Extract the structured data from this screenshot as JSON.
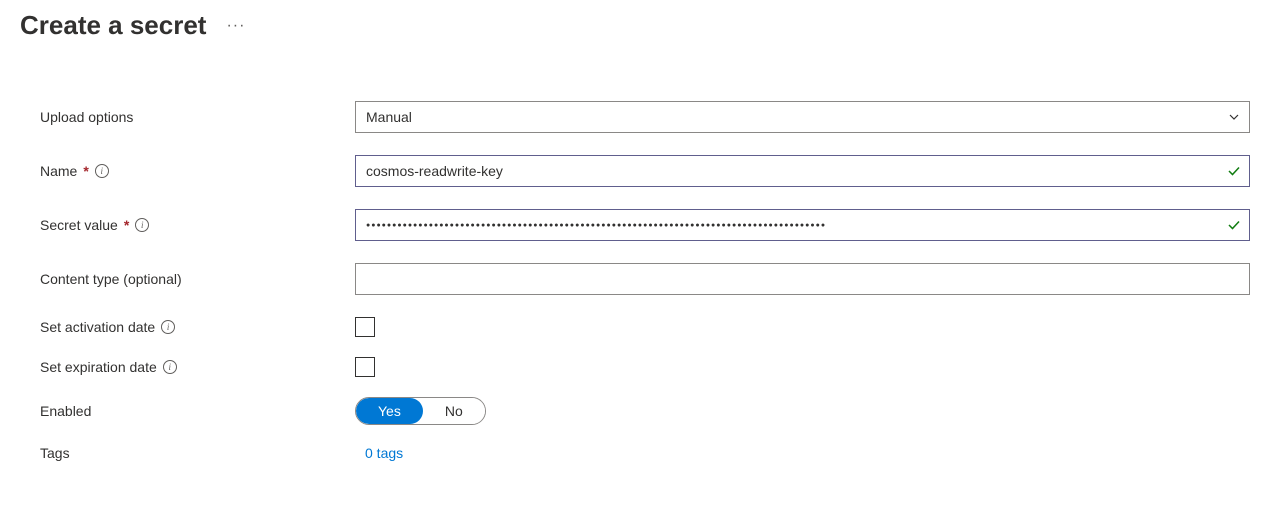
{
  "header": {
    "title": "Create a secret",
    "more": "···"
  },
  "labels": {
    "upload_options": "Upload options",
    "name": "Name",
    "secret_value": "Secret value",
    "content_type": "Content type (optional)",
    "set_activation": "Set activation date",
    "set_expiration": "Set expiration date",
    "enabled": "Enabled",
    "tags": "Tags"
  },
  "values": {
    "upload_options_selected": "Manual",
    "name": "cosmos-readwrite-key",
    "secret_value_masked": "●●●●●●●●●●●●●●●●●●●●●●●●●●●●●●●●●●●●●●●●●●●●●●●●●●●●●●●●●●●●●●●●●●●●●●●●●●●●●●●●●●●●●●●●",
    "content_type": "",
    "set_activation": false,
    "set_expiration": false,
    "enabled_yes": "Yes",
    "enabled_no": "No",
    "tags_link": "0 tags"
  }
}
